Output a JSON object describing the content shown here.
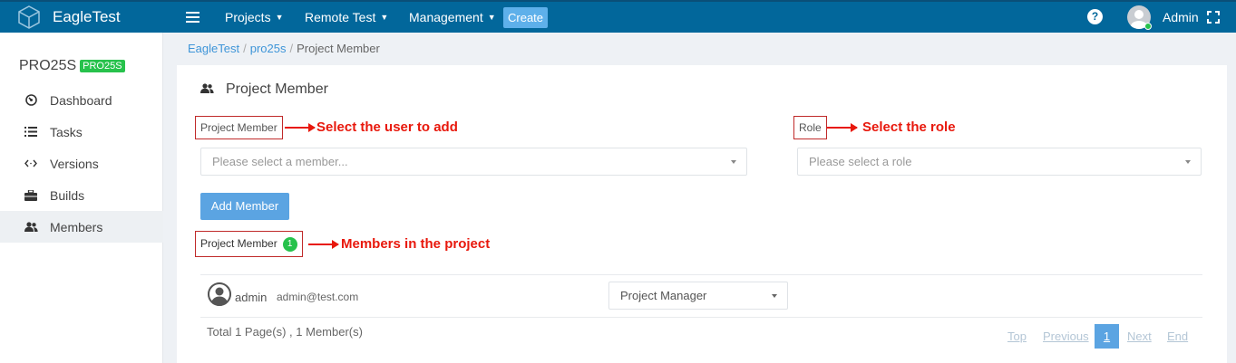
{
  "topbar": {
    "brand": "EagleTest",
    "nav": [
      {
        "label": "Projects"
      },
      {
        "label": "Remote Test"
      },
      {
        "label": "Management"
      }
    ],
    "create_label": "Create",
    "help_label": "?",
    "user_label": "Admin"
  },
  "sidebar": {
    "project_name": "PRO25S",
    "project_badge": "PRO25S",
    "items": [
      {
        "label": "Dashboard",
        "icon": "dashboard-icon"
      },
      {
        "label": "Tasks",
        "icon": "list-icon"
      },
      {
        "label": "Versions",
        "icon": "code-icon"
      },
      {
        "label": "Builds",
        "icon": "briefcase-icon"
      },
      {
        "label": "Members",
        "icon": "users-icon",
        "active": true
      }
    ]
  },
  "breadcrumb": [
    "EagleTest",
    "pro25s",
    "Project Member"
  ],
  "panel": {
    "title": "Project Member",
    "member_field_label": "Project Member",
    "member_placeholder": "Please select a member...",
    "role_field_label": "Role",
    "role_placeholder": "Please select a role",
    "add_button": "Add Member",
    "members_label": "Project Member",
    "members_count": "1",
    "annotations": {
      "select_user": "Select the user to add",
      "select_role": "Select the role",
      "members_in_project": "Members in the project"
    },
    "members": [
      {
        "name": "admin",
        "email": "admin@test.com",
        "role": "Project Manager"
      }
    ],
    "total_text": "Total 1 Page(s) ,  1 Member(s)",
    "pager": {
      "top": "Top",
      "previous": "Previous",
      "current": "1",
      "next": "Next",
      "end": "End"
    }
  },
  "colors": {
    "topbar": "#02679b",
    "accent": "#5ba4e2",
    "badge_green": "#27c24c",
    "annotation_red": "#e8180c"
  }
}
